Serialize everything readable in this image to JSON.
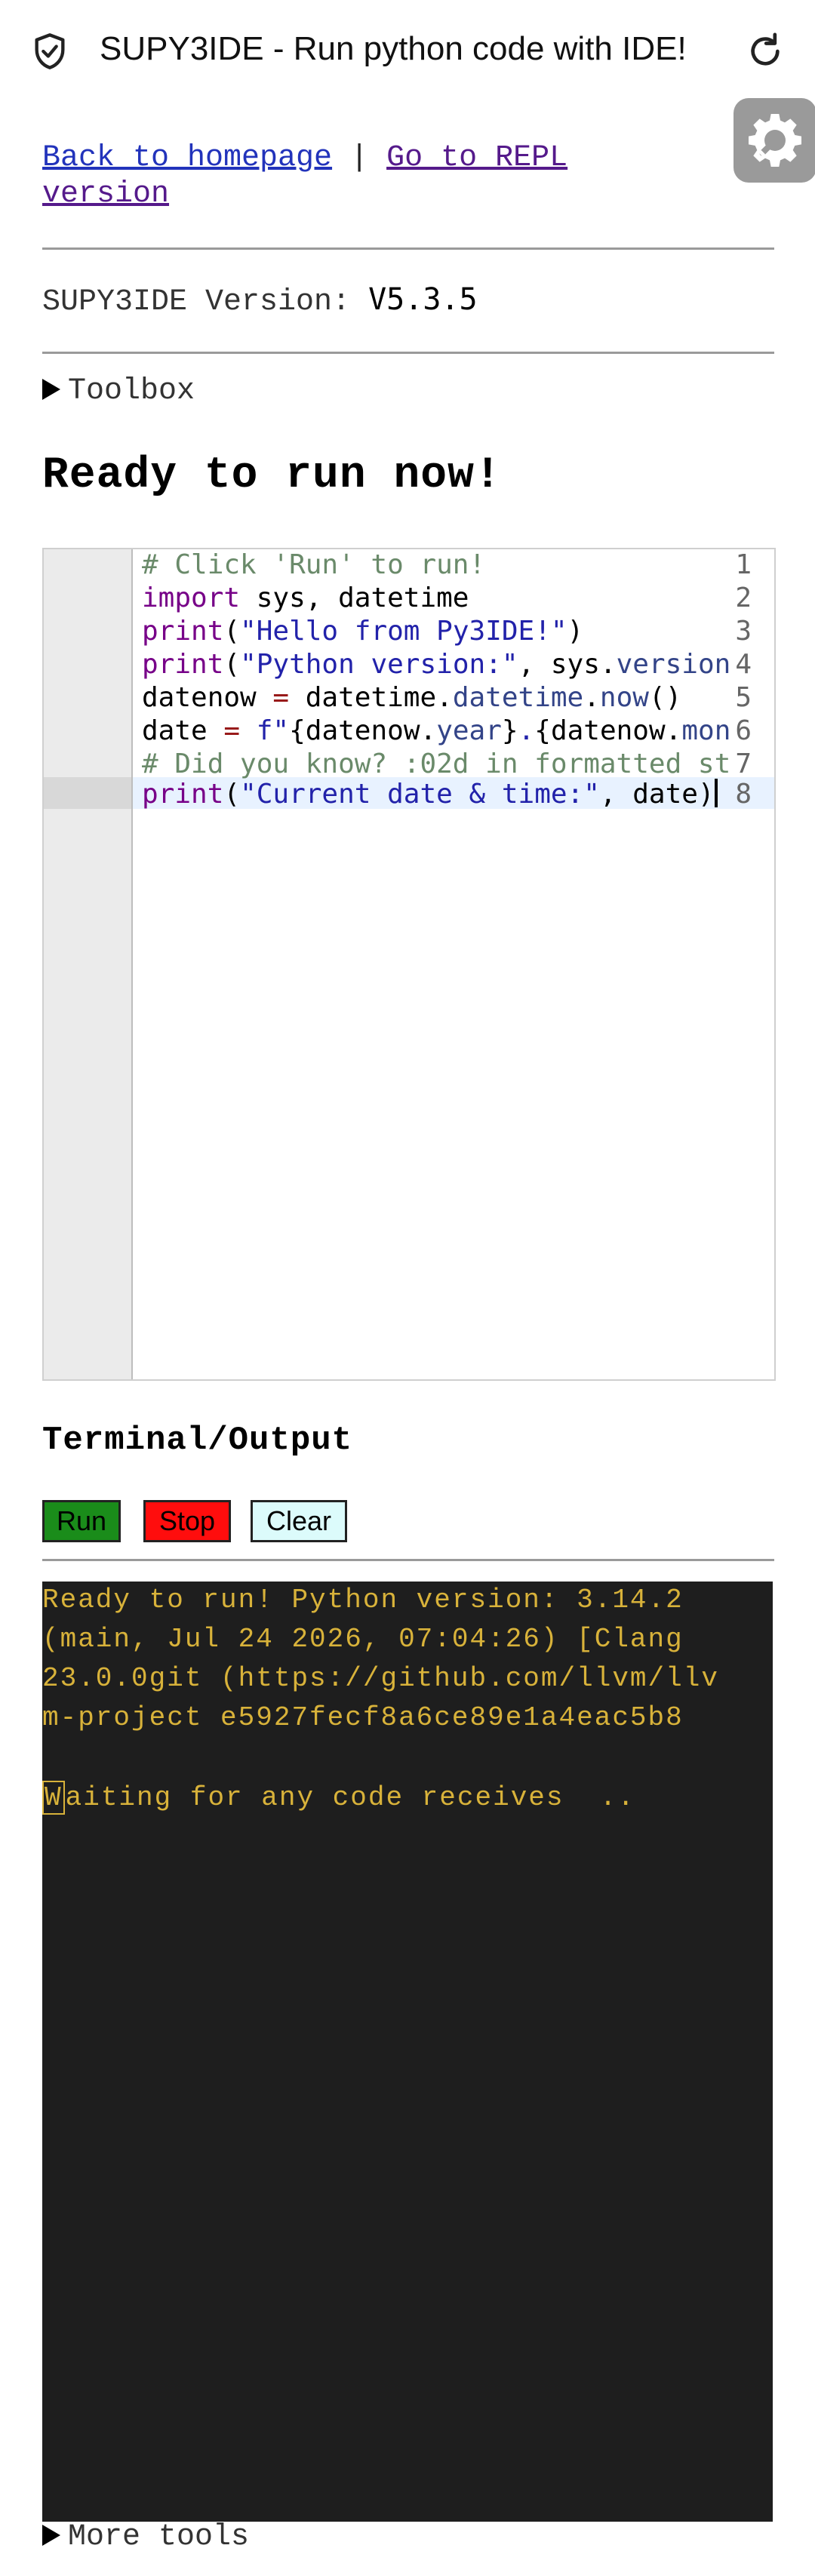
{
  "appbar": {
    "title": "SUPY3IDE - Run python code with IDE!",
    "left_icon": "shield-check-icon",
    "right_icon": "reload-icon"
  },
  "settings": {
    "icon": "gear-icon"
  },
  "nav": {
    "back_label": "Back to homepage",
    "separator": " | ",
    "repl_label": "Go to REPL version"
  },
  "version": {
    "label": "SUPY3IDE Version: ",
    "value": "V5.3.5"
  },
  "toolbox": {
    "label": "Toolbox"
  },
  "heading": "Ready to run now!",
  "editor": {
    "line_numbers": [
      "1",
      "2",
      "3",
      "4",
      "5",
      "6",
      "7",
      "8"
    ],
    "lines": [
      "# Click 'Run' to run!",
      "import sys, datetime",
      "print(\"Hello from Py3IDE!\")",
      "print(\"Python version:\", sys.version",
      "datenow = datetime.datetime.now()",
      "date = f\"{datenow.year}.{datenow.mont",
      "# Did you know? :02d in formatted st",
      "print(\"Current date & time:\", date)"
    ]
  },
  "terminal": {
    "title": "Terminal/Output",
    "run_label": "Run",
    "stop_label": "Stop",
    "clear_label": "Clear",
    "output_lines": [
      "Ready to run! Python version: 3.14.2",
      "(main, Jul 24 2026, 07:04:26) [Clang",
      "23.0.0git (https://github.com/llvm/llv",
      "m-project e5927fecf8a6ce89e1a4eac5b8"
    ],
    "waiting_first": "W",
    "waiting_rest": "aiting for any code receives  .."
  },
  "more_tools": {
    "label": "More tools"
  },
  "colors": {
    "run": "#1a8c1a",
    "stop": "#ff0d0d",
    "clear": "#dcfbfb",
    "terminal_bg": "#1e1e1e",
    "terminal_text": "#d8b23a"
  }
}
